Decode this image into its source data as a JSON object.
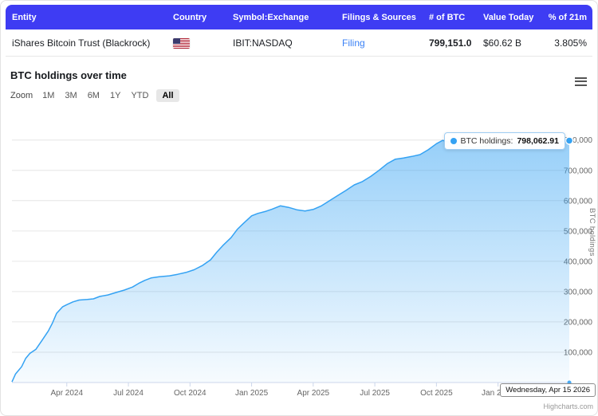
{
  "colors": {
    "header_bg": "#3e3cf3",
    "link": "#3b82f6",
    "accent": "#34a2f3"
  },
  "table": {
    "headers": [
      "Entity",
      "Country",
      "Symbol:Exchange",
      "Filings & Sources",
      "# of BTC",
      "Value Today",
      "% of 21m"
    ],
    "row": {
      "entity": "iShares Bitcoin Trust (Blackrock)",
      "country_flag": "us-flag",
      "symbol_exchange": "IBIT:NASDAQ",
      "filing_link": "Filing",
      "btc": "799,151.0",
      "value_today": "$60.62 B",
      "pct_21m": "3.805%"
    }
  },
  "chart_section": {
    "title": "BTC holdings over time",
    "zoom_label": "Zoom",
    "zoom_buttons": [
      "1M",
      "3M",
      "6M",
      "1Y",
      "YTD",
      "All"
    ],
    "zoom_selected": "All",
    "yaxis_title": "BTC holdings",
    "tooltip": {
      "label": "BTC holdings:",
      "value": "798,062.91"
    },
    "crosshair_label": "Wednesday, Apr 15 2026",
    "credit": "Highcharts.com"
  },
  "chart_data": {
    "type": "area",
    "title": "BTC holdings over time",
    "ylabel": "BTC holdings",
    "x_unit": "months since 2024-01-01 (0 = Jan 1 2024)",
    "xlim": [
      0.33,
      27.47
    ],
    "ylim": [
      0,
      865000
    ],
    "grid": "horizontal",
    "legend": false,
    "yticks": [
      100000,
      200000,
      300000,
      400000,
      500000,
      600000,
      700000,
      800000
    ],
    "xticks": [
      {
        "m": 3,
        "label": "Apr 2024"
      },
      {
        "m": 6,
        "label": "Jul 2024"
      },
      {
        "m": 9,
        "label": "Oct 2024"
      },
      {
        "m": 12,
        "label": "Jan 2025"
      },
      {
        "m": 15,
        "label": "Apr 2025"
      },
      {
        "m": 18,
        "label": "Jul 2025"
      },
      {
        "m": 21,
        "label": "Oct 2025"
      },
      {
        "m": 24,
        "label": "Jan 2026"
      }
    ],
    "colors": {
      "line": "#34a2f3",
      "fill": "#34a2f3",
      "grid": "#e6e6e6",
      "axis": "#ccd6eb"
    },
    "series": [
      {
        "name": "BTC holdings",
        "last_point_label": "798,062.91",
        "points": [
          [
            0.33,
            2000
          ],
          [
            0.5,
            28000
          ],
          [
            0.8,
            52000
          ],
          [
            1.0,
            80000
          ],
          [
            1.2,
            96000
          ],
          [
            1.5,
            110000
          ],
          [
            1.8,
            140000
          ],
          [
            2.1,
            170000
          ],
          [
            2.3,
            196000
          ],
          [
            2.5,
            228000
          ],
          [
            2.8,
            250000
          ],
          [
            3.0,
            257000
          ],
          [
            3.3,
            266000
          ],
          [
            3.6,
            272000
          ],
          [
            4.0,
            274000
          ],
          [
            4.3,
            276000
          ],
          [
            4.6,
            284000
          ],
          [
            5.0,
            289000
          ],
          [
            5.4,
            297000
          ],
          [
            5.8,
            305000
          ],
          [
            6.2,
            315000
          ],
          [
            6.5,
            327000
          ],
          [
            6.8,
            337000
          ],
          [
            7.1,
            345000
          ],
          [
            7.5,
            349000
          ],
          [
            8.0,
            352000
          ],
          [
            8.4,
            357000
          ],
          [
            8.8,
            363000
          ],
          [
            9.2,
            372000
          ],
          [
            9.6,
            386000
          ],
          [
            10.0,
            405000
          ],
          [
            10.3,
            430000
          ],
          [
            10.6,
            452000
          ],
          [
            11.0,
            478000
          ],
          [
            11.3,
            505000
          ],
          [
            11.6,
            525000
          ],
          [
            12.0,
            550000
          ],
          [
            12.3,
            558000
          ],
          [
            12.7,
            565000
          ],
          [
            13.0,
            572000
          ],
          [
            13.4,
            583000
          ],
          [
            13.8,
            578000
          ],
          [
            14.2,
            570000
          ],
          [
            14.6,
            566000
          ],
          [
            15.0,
            571000
          ],
          [
            15.4,
            583000
          ],
          [
            15.8,
            600000
          ],
          [
            16.2,
            617000
          ],
          [
            16.6,
            634000
          ],
          [
            17.0,
            652000
          ],
          [
            17.4,
            663000
          ],
          [
            17.8,
            680000
          ],
          [
            18.2,
            700000
          ],
          [
            18.6,
            722000
          ],
          [
            19.0,
            737000
          ],
          [
            19.4,
            741000
          ],
          [
            19.8,
            746000
          ],
          [
            20.2,
            752000
          ],
          [
            20.6,
            768000
          ],
          [
            21.0,
            788000
          ],
          [
            21.3,
            799000
          ],
          [
            21.6,
            793000
          ],
          [
            22.0,
            786000
          ],
          [
            22.4,
            779000
          ],
          [
            22.8,
            773000
          ],
          [
            23.2,
            778000
          ],
          [
            23.6,
            784000
          ],
          [
            24.0,
            789000
          ],
          [
            24.4,
            784000
          ],
          [
            24.8,
            789000
          ],
          [
            25.2,
            786000
          ],
          [
            25.6,
            792000
          ],
          [
            26.0,
            789000
          ],
          [
            26.4,
            794000
          ],
          [
            26.8,
            792000
          ],
          [
            27.2,
            796000
          ],
          [
            27.47,
            798062.91
          ]
        ]
      }
    ]
  }
}
